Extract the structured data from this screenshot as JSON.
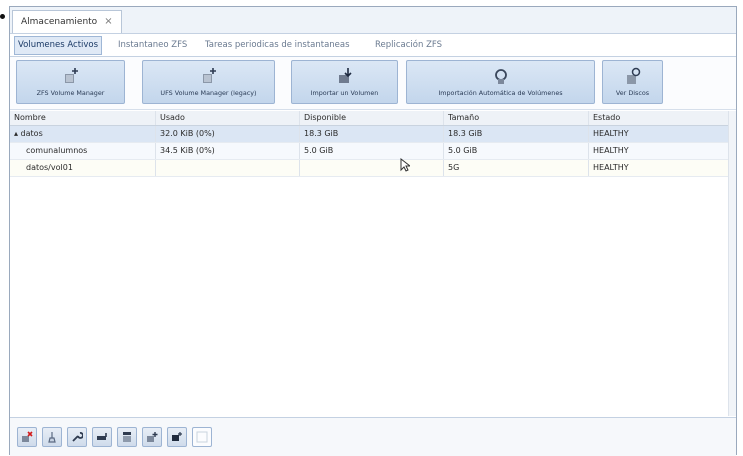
{
  "window": {
    "tab_label": "Almacenamiento",
    "tab_close": "×"
  },
  "subtabs": [
    {
      "label": "Volumenes Activos",
      "active": true
    },
    {
      "label": "Instantaneo ZFS",
      "active": false
    },
    {
      "label": "Tareas periodicas de instantaneas",
      "active": false
    },
    {
      "label": "Replicación ZFS",
      "active": false
    }
  ],
  "toolbar": [
    {
      "label": "ZFS Volume Manager",
      "icon": "disk-add-icon"
    },
    {
      "label": "UFS Volume Manager (legacy)",
      "icon": "disk-add-icon"
    },
    {
      "label": "Importar un Volumen",
      "icon": "import-icon"
    },
    {
      "label": "Importación Automática de Volúmenes",
      "icon": "auto-import-icon"
    },
    {
      "label": "Ver Discos",
      "icon": "view-disks-icon"
    }
  ],
  "table": {
    "headers": [
      "Nombre",
      "Usado",
      "Disponible",
      "Tamaño",
      "Estado"
    ],
    "rows": [
      {
        "name": "▴ datos",
        "used": "32.0 KiB (0%)",
        "available": "18.3 GiB",
        "size": "18.3 GiB",
        "status": "HEALTHY"
      },
      {
        "name": "comunalumnos",
        "used": "34.5 KiB (0%)",
        "available": "5.0 GiB",
        "size": "5.0 GiB",
        "status": "HEALTHY"
      },
      {
        "name": "datos/vol01",
        "used": "",
        "available": "",
        "size": "5G",
        "status": "HEALTHY"
      }
    ]
  },
  "bottom_actions": [
    {
      "icon": "detach-volume-icon"
    },
    {
      "icon": "scrub-icon"
    },
    {
      "icon": "wrench-icon"
    },
    {
      "icon": "change-permissions-icon"
    },
    {
      "icon": "create-dataset-icon"
    },
    {
      "icon": "create-zvol-icon"
    },
    {
      "icon": "snapshot-icon"
    },
    {
      "icon": "blank-icon"
    }
  ],
  "colors": {
    "accent": "#c3d6ec",
    "border": "#9db4d3",
    "selected_row": "#dbe6f4",
    "text_dark": "#1b3a66"
  }
}
